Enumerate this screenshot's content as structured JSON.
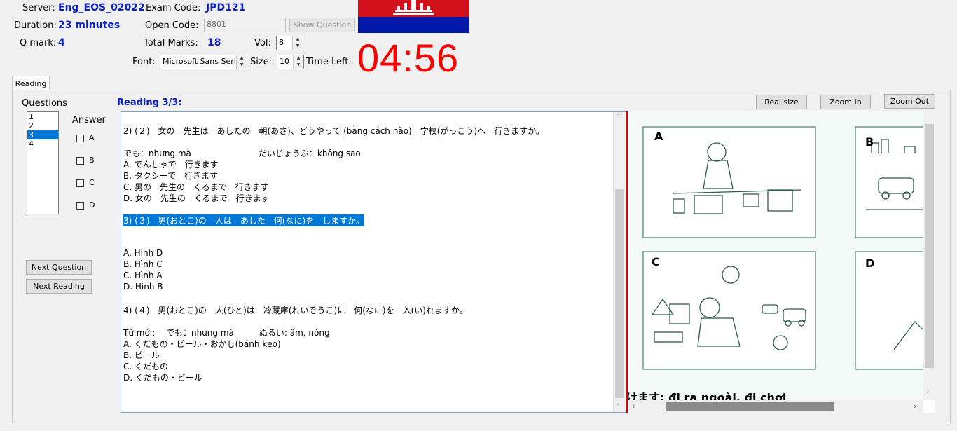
{
  "header": {
    "server_label": "Server:",
    "server_value": "Eng_EOS_02022",
    "exam_code_label": "Exam Code:",
    "exam_code_value": "JPD121",
    "duration_label": "Duration:",
    "duration_value": "23 minutes",
    "open_code_label": "Open Code:",
    "open_code_value": "8801",
    "show_question_label": "Show Question",
    "qmark_label": "Q mark:",
    "qmark_value": "4",
    "total_marks_label": "Total Marks:",
    "total_marks_value": "18",
    "vol_label": "Vol:",
    "vol_value": "8",
    "font_label": "Font:",
    "font_value": "Microsoft Sans Serif",
    "size_label": "Size:",
    "size_value": "10",
    "time_left_label": "Time Left:",
    "timer": "04:56",
    "flag_colors": {
      "top": "#d2101c",
      "bottom": "#0018a8",
      "emblem": "#ffffff"
    }
  },
  "tabs": [
    {
      "label": "Reading",
      "active": true
    }
  ],
  "left": {
    "questions_label": "Questions",
    "questions": [
      "1",
      "2",
      "3",
      "4"
    ],
    "selected_question": "3",
    "answer_label": "Answer",
    "answers": [
      "A",
      "B",
      "C",
      "D"
    ],
    "next_question_label": "Next Question",
    "next_reading_label": "Next Reading"
  },
  "reading": {
    "title": "Reading 3/3:",
    "lines": [
      "2) (２)　女の　先生は　あしたの　朝(あさ)、どうやって (bằng cách nào)　学校(がっこう)へ　行きますか。",
      "",
      "でも：nhưng mà　　　　　　　　だいじょうぶ：không sao",
      "A. でんしゃで　行きます",
      "B. タクシーで　行きます",
      "C. 男の　先生の　くるまで　行きます",
      "D. 女の　先生の　くるまで　行きます",
      "",
      "3) (３)　男(おとこ)の　人は　あした　何(なに)を　しますか。",
      "",
      "",
      "A.  Hình D",
      "B.  Hình C",
      "C.  Hình A",
      "D.  Hình B",
      "",
      "4) (４)　男(おとこ)の　人(ひと)は　冷蔵庫(れいぞうこ)に　何(なに)を　入(い)れますか。",
      "",
      "Từ mới:　 でも：nhưng mà　　　ぬるい: ấm, nóng",
      "A. くだもの・ビール・おかし(bánh kẹo)",
      "B. ビール",
      "C. くだもの",
      "D. くだもの・ビール"
    ],
    "selected_line": 8
  },
  "image_panel": {
    "real_size_label": "Real size",
    "zoom_in_label": "Zoom In",
    "zoom_out_label": "Zoom Out",
    "panel_labels": [
      "A",
      "B",
      "C",
      "D"
    ],
    "caption": "かけます: đi ra ngoài, đi chơi"
  }
}
